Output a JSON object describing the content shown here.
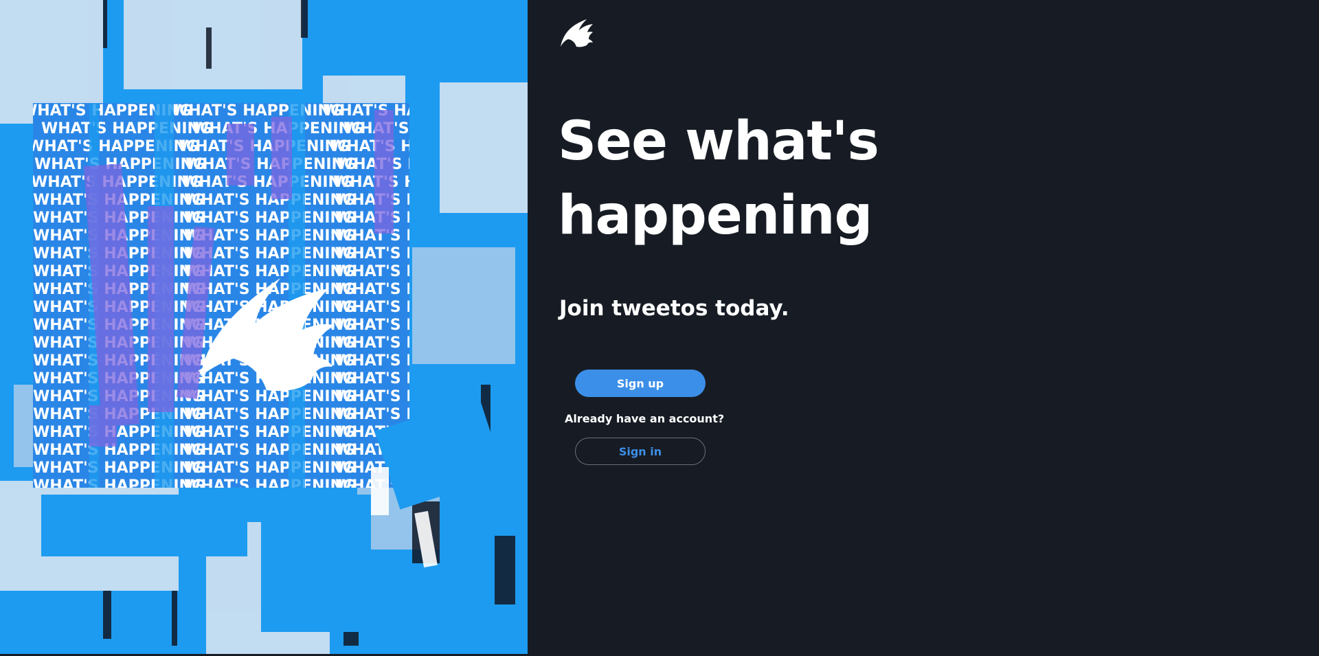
{
  "hero": {
    "pattern_text": "WHAT'S HAPPENING",
    "icon": "bird-icon",
    "colors": {
      "blue": "#1d9bf0",
      "light": "#dfe7f2",
      "purple": "#7b66e0",
      "dark": "#111826"
    }
  },
  "brand": {
    "icon": "bird-icon"
  },
  "headline": {
    "line1": "See what's",
    "line2": "happening"
  },
  "subhead": "Join tweetos today.",
  "actions": {
    "signup_label": "Sign up",
    "account_prompt": "Already have an account?",
    "signin_label": "Sign in"
  },
  "colors": {
    "background": "#171c24",
    "accent": "#3b8fe8",
    "text": "#ffffff"
  }
}
